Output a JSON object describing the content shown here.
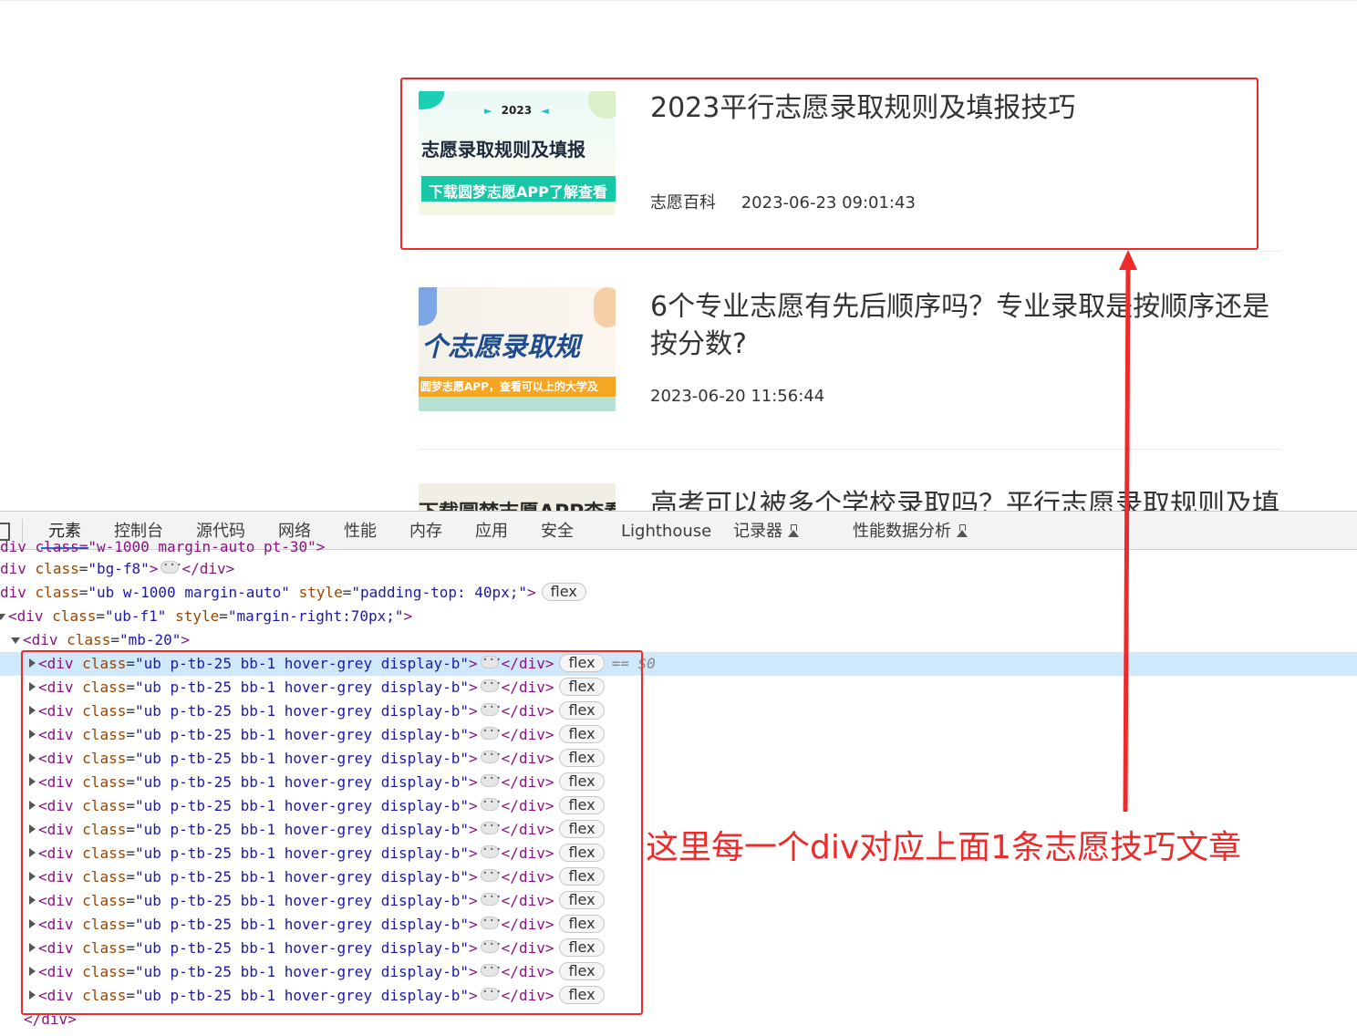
{
  "articles": [
    {
      "title": "2023平行志愿录取规则及填报技巧",
      "category": "志愿百科",
      "date": "2023-06-23 09:01:43",
      "thumb": {
        "year": "2023",
        "headline": "志愿录取规则及填报",
        "banner": "下载圆梦志愿APP了解查看"
      }
    },
    {
      "title": "6个专业志愿有先后顺序吗？专业录取是按顺序还是按分数?",
      "category": "",
      "date": "2023-06-20 11:56:44",
      "thumb": {
        "headline": "个志愿录取规",
        "banner": "圆梦志愿APP，查看可以上的大学及"
      }
    },
    {
      "title": "高考可以被多个学校录取吗？平行志愿录取规则及填",
      "category": "",
      "date": "",
      "thumb": {
        "headline": "下载圆梦志愿APP查看"
      }
    }
  ],
  "devtools": {
    "tabs": [
      "元素",
      "控制台",
      "源代码",
      "网络",
      "性能",
      "内存",
      "应用",
      "安全",
      "Lighthouse",
      "记录器",
      "性能数据分析"
    ],
    "active_tab": "元素",
    "dom_lines": {
      "l0": "div class=\"w-1000 margin-auto pt-30\">",
      "l1_tag": "div",
      "l1_attr": "class",
      "l1_val": "\"bg-f8\"",
      "l2_tag": "div",
      "l2_attr1": "class",
      "l2_val1": "\"ub w-1000 margin-auto\"",
      "l2_attr2": "style",
      "l2_val2": "\"padding-top: 40px;\"",
      "l3_tag": "<div",
      "l3_attr1": "class",
      "l3_val1": "\"ub-f1\"",
      "l3_attr2": "style",
      "l3_val2": "\"margin-right:70px;\"",
      "l4_tag": "<div",
      "l4_attr": "class",
      "l4_val": "\"mb-20\"",
      "item_tag": "<div",
      "item_attr": "class",
      "item_val": "\"ub p-tb-25 bb-1 hover-grey display-b\"",
      "close_div": "</div>",
      "flex": "flex",
      "selected_marker": "== $0",
      "lt": "<",
      "gt": ">",
      "eq": "=",
      "last": "</div>"
    },
    "child_count": 15
  },
  "annotation": "这里每一个div对应上面1条志愿技巧文章",
  "colors": {
    "annotation": "#ee2b2b",
    "selected_row": "#cfe8fc",
    "tag": "#881280",
    "attr": "#994500",
    "value": "#1a1aa6"
  }
}
